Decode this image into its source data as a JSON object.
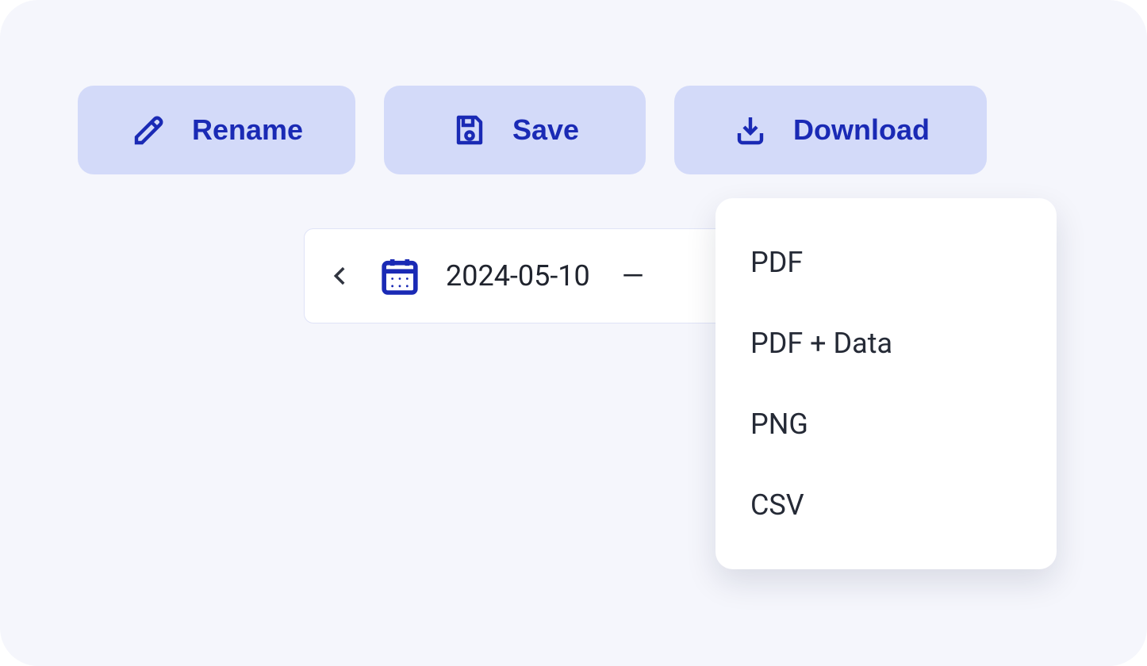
{
  "toolbar": {
    "rename_label": "Rename",
    "save_label": "Save",
    "download_label": "Download"
  },
  "date_range": {
    "start": "2024-05-10",
    "separator": "—"
  },
  "download_menu": {
    "items": [
      "PDF",
      "PDF + Data",
      "PNG",
      "CSV"
    ]
  },
  "colors": {
    "button_bg": "#d3daf9",
    "button_text": "#1a2ab5",
    "panel_bg": "#f5f6fc"
  }
}
